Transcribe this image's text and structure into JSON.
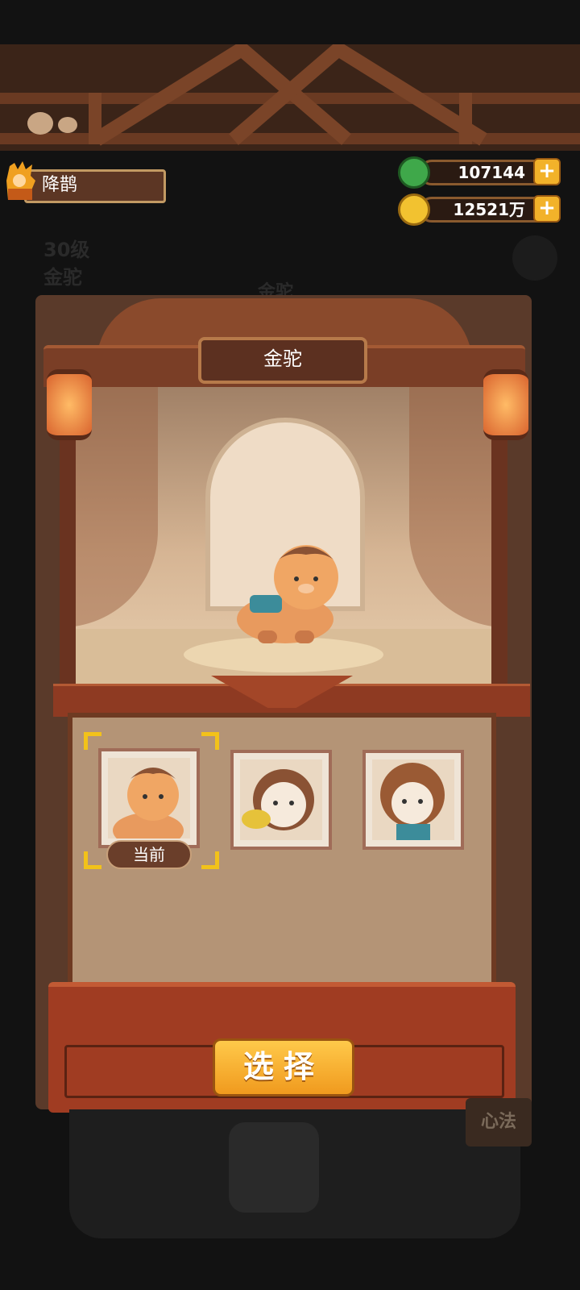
{
  "player": {
    "name": "降鹊"
  },
  "resources": {
    "jade": "107144",
    "coins": "12521万"
  },
  "background": {
    "level_text": "30级",
    "mount_name": "金驼",
    "tab_text": "金驼"
  },
  "panel": {
    "title": "金驼",
    "current_label": "当前",
    "select_button": "选择",
    "skins": [
      {
        "name": "camel-skin-1",
        "current": true
      },
      {
        "name": "camel-skin-2",
        "current": false
      },
      {
        "name": "camel-skin-3",
        "current": false
      }
    ]
  },
  "side_button": {
    "label": "心法"
  },
  "colors": {
    "accent_gold": "#f2b22a",
    "frame_brown": "#5a3a2a",
    "button_orange": "#f09a1e"
  }
}
